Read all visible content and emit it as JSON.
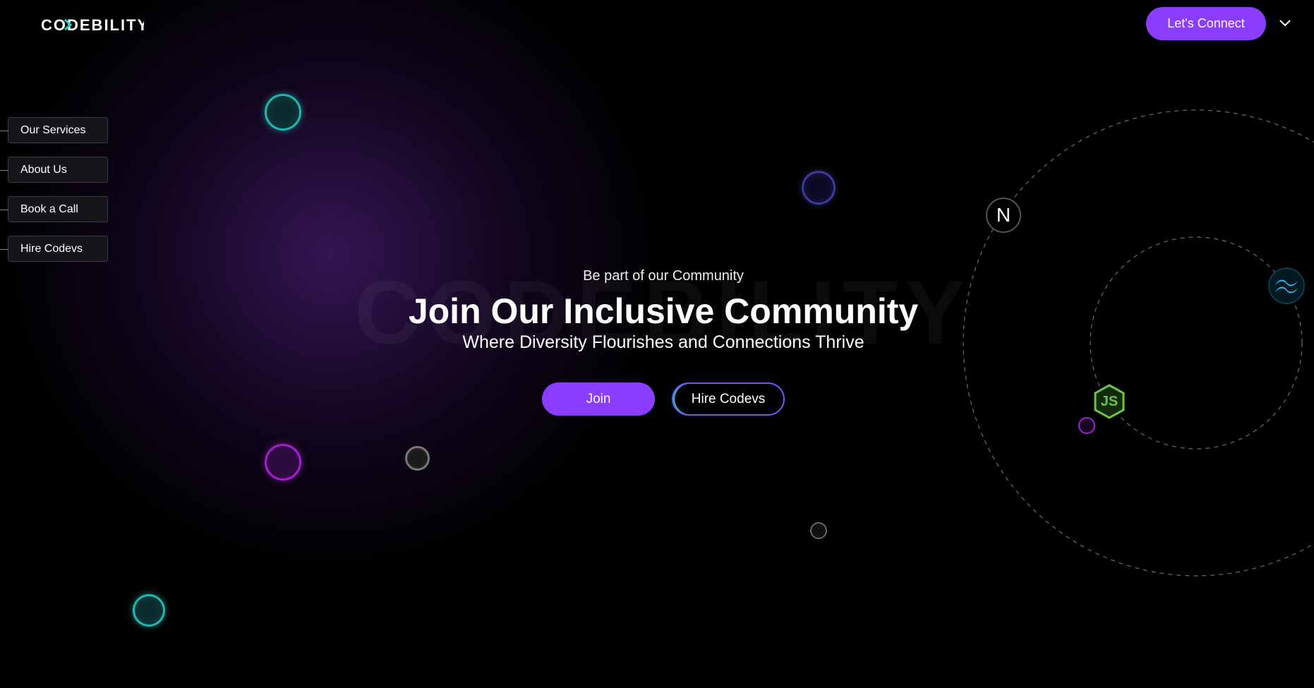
{
  "header": {
    "logo_text": "CODEBILITY",
    "connect_label": "Let's Connect"
  },
  "side_nav": {
    "items": [
      {
        "label": "Our Services"
      },
      {
        "label": "About Us"
      },
      {
        "label": "Book a Call"
      },
      {
        "label": "Hire Codevs"
      }
    ]
  },
  "hero": {
    "watermark": "CODEBILITY",
    "eyebrow": "Be part of our Community",
    "title": "Join Our Inclusive Community",
    "subtitle": "Where Diversity Flourishes and Connections Thrive",
    "join_label": "Join",
    "hire_label": "Hire Codevs"
  },
  "tech_icons": [
    {
      "name": "nextjs-icon",
      "glyph": "N"
    },
    {
      "name": "tailwind-icon"
    },
    {
      "name": "nodejs-icon",
      "glyph": "JS"
    }
  ],
  "colors": {
    "accent": "#8b3dff",
    "teal": "#22d3c5",
    "background": "#000000"
  }
}
